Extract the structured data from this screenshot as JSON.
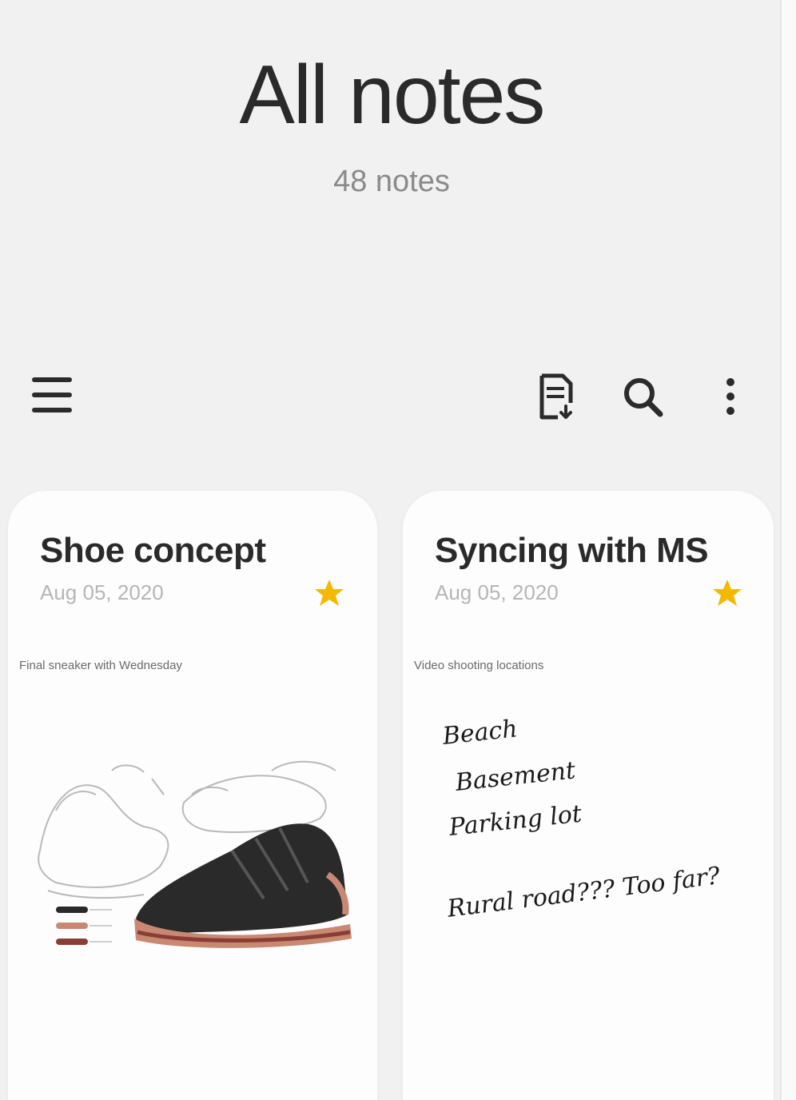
{
  "header": {
    "title": "All notes",
    "subtitle": "48 notes"
  },
  "toolbar": {
    "menu_icon": "hamburger-menu-icon",
    "actions": [
      {
        "name": "pdf-import-icon"
      },
      {
        "name": "search-icon"
      },
      {
        "name": "more-options-icon"
      }
    ]
  },
  "notes": [
    {
      "title": "Shoe concept",
      "date": "Aug 05, 2020",
      "favorite": true,
      "preview": "Final sneaker with Wednesday",
      "thumbnail": "sneaker sketch"
    },
    {
      "title": "Syncing with MS",
      "date": "Aug 05, 2020",
      "favorite": true,
      "preview": "Video shooting locations",
      "handwriting": [
        "Beach",
        "Basement",
        "Parking lot",
        "Rural road??? Too far?"
      ]
    }
  ],
  "colors": {
    "background": "#f1f1f1",
    "card": "#fdfdfd",
    "star": "#f5b800",
    "title_text": "#2a2a2a",
    "secondary_text": "#8a8a8a"
  }
}
